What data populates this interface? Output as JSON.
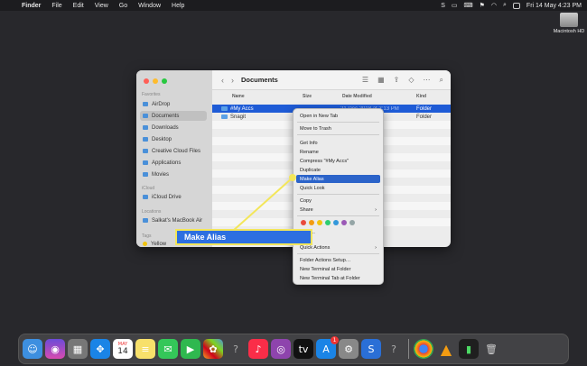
{
  "menubar": {
    "app_name": "Finder",
    "menus": [
      "File",
      "Edit",
      "View",
      "Go",
      "Window",
      "Help"
    ],
    "datetime": "Fri 14 May  4:23 PM"
  },
  "desktop": {
    "drive_label": "Macintosh HD"
  },
  "window": {
    "title": "Documents",
    "sidebar": {
      "sections": {
        "favorites": "Favorites",
        "icloud": "iCloud",
        "locations": "Locations",
        "tags": "Tags"
      },
      "favorites": [
        "AirDrop",
        "Documents",
        "Downloads",
        "Desktop",
        "Creative Cloud Files",
        "Applications",
        "Movies"
      ],
      "icloud": [
        "iCloud Drive"
      ],
      "locations": [
        "Salkat's MacBook Air"
      ],
      "tags": [
        "Yellow"
      ]
    },
    "columns": {
      "name": "Name",
      "size": "Size",
      "date": "Date Modified",
      "kind": "Kind"
    },
    "files": [
      {
        "name": "#My Accs",
        "date": "21 Dec 2018 at 2:13 PM",
        "kind": "Folder"
      },
      {
        "name": "Snagit",
        "date": "",
        "kind": "Folder"
      }
    ]
  },
  "context_menu": {
    "items": [
      "Open in New Tab",
      "Move to Trash",
      "Get Info",
      "Rename",
      "Compress \"#My Accs\"",
      "Duplicate",
      "Make Alias",
      "Quick Look",
      "Copy",
      "Share",
      "Tags…",
      "Quick Actions",
      "Folder Actions Setup…",
      "New Terminal at Folder",
      "New Terminal Tab at Folder"
    ],
    "selected": "Make Alias",
    "tag_colors": [
      "#e94b3c",
      "#f39c12",
      "#f1c40f",
      "#2ecc71",
      "#3498db",
      "#9b59b6",
      "#95a5a6"
    ]
  },
  "callout": {
    "label": "Make Alias"
  },
  "dock": {
    "calendar_month": "MAY",
    "calendar_day": "14",
    "appstore_badge": "1"
  },
  "colors": {
    "selection": "#1e5bd6",
    "menu_highlight": "#2b63c9",
    "callout": "#f3e65a"
  }
}
